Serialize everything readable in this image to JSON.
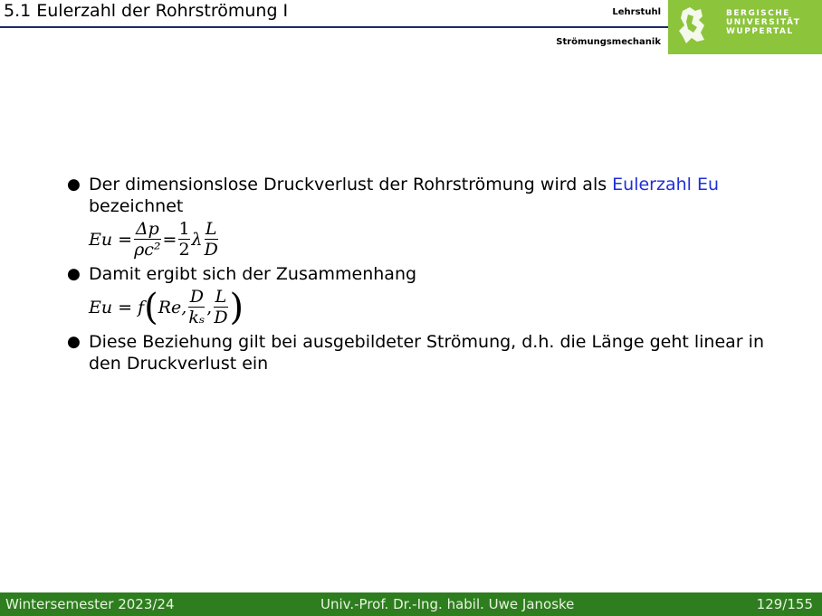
{
  "header": {
    "title": "5.1 Eulerzahl der Rohrströmung I",
    "chair_line1": "Lehrstuhl",
    "chair_line2": "Strömungsmechanik",
    "university": [
      "BERGISCHE",
      "UNIVERSITÄT",
      "WUPPERTAL"
    ]
  },
  "content": {
    "b1_text": "Der dimensionslose Druckverlust der Rohrströmung wird als ",
    "b1_term": "Eulerzahl Eu",
    "b1_tail": "bezeichnet",
    "eq1": {
      "lhs": "Eu =",
      "n1": "Δp",
      "d1": "ρc²",
      "mid": "=",
      "n2": "1",
      "d2": "2",
      "lambda": "λ",
      "n3": "L",
      "d3": "D"
    },
    "b2_text": "Damit ergibt sich der Zusammenhang",
    "eq2": {
      "lhs": "Eu = f",
      "re": "Re,",
      "n1": "D",
      "d1": "kₛ",
      "comma": ",",
      "n2": "L",
      "d2": "D"
    },
    "b3_text": "Diese Beziehung gilt bei ausgebildeter Strömung, d.h. die Länge geht linear in den Druckverlust ein"
  },
  "footer": {
    "semester": "Wintersemester 2023/24",
    "author": "Univ.-Prof. Dr.-Ing. habil. Uwe Janoske",
    "page": "129/155"
  }
}
